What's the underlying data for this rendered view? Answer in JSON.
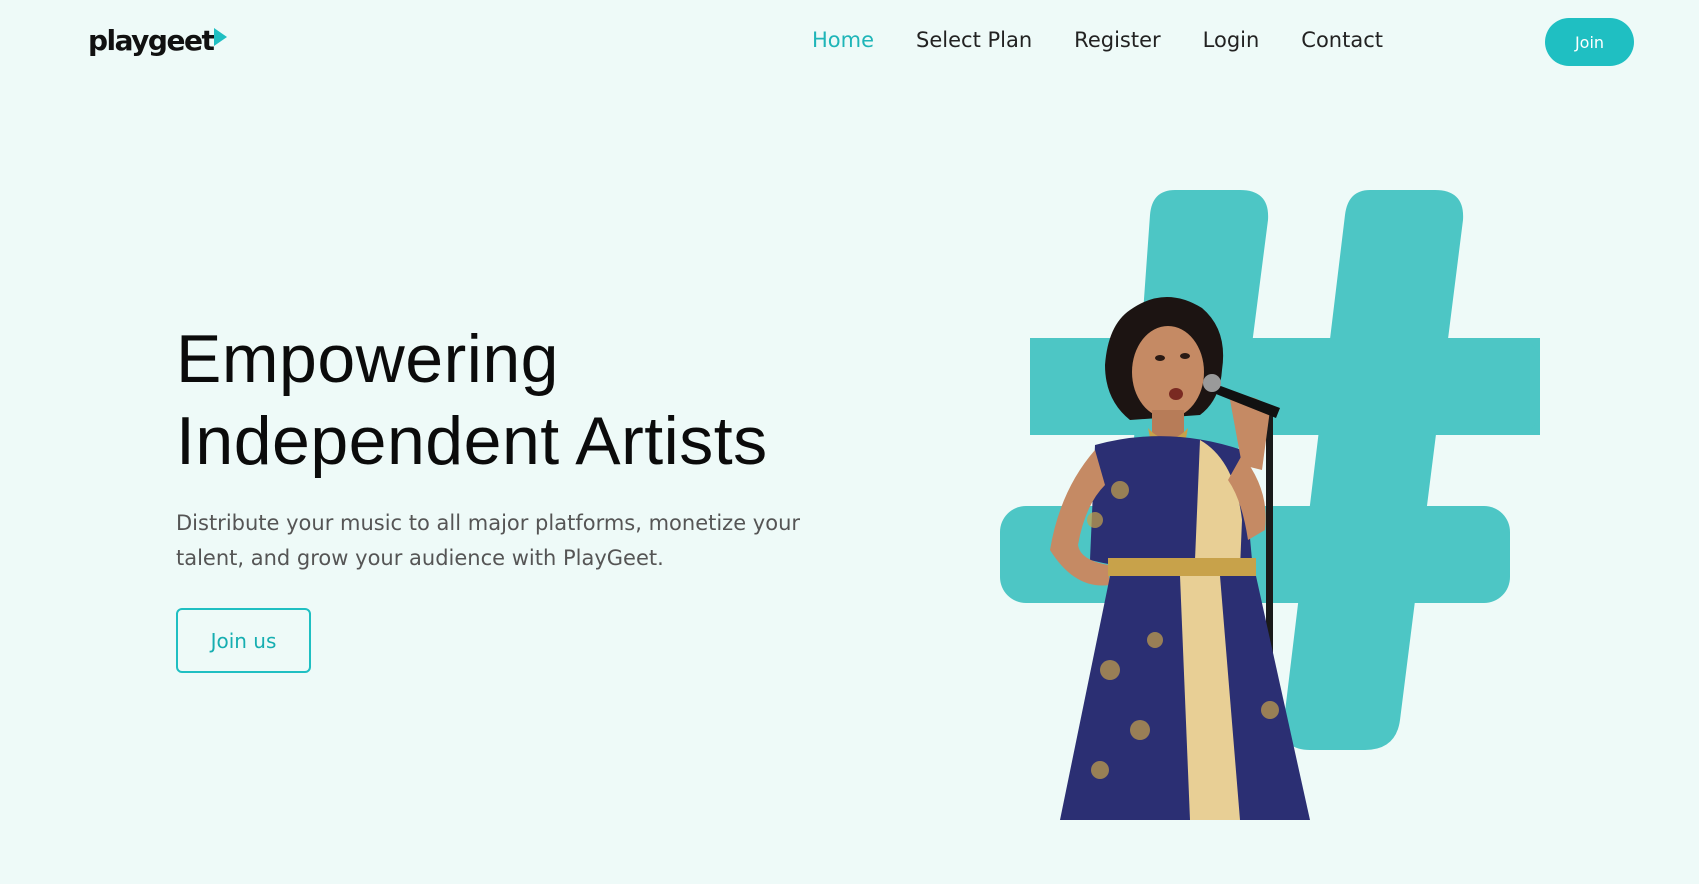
{
  "header": {
    "logo": "playgeet",
    "nav": [
      {
        "label": "Home",
        "active": true
      },
      {
        "label": "Select Plan",
        "active": false
      },
      {
        "label": "Register",
        "active": false
      },
      {
        "label": "Login",
        "active": false
      },
      {
        "label": "Contact",
        "active": false
      }
    ],
    "join_label": "Join"
  },
  "hero": {
    "title_line1": "Empowering",
    "title_line2": "Independent Artists",
    "subtitle": "Distribute your music to all major platforms, monetize your talent, and grow your audience with PlayGeet.",
    "cta_label": "Join us"
  },
  "colors": {
    "accent": "#1fbfc2",
    "hash": "#4dc6c5",
    "background": "#eefaf8"
  },
  "icons": {
    "logo_mark": "play-triangle-icon",
    "hero_graphic": "hashtag-icon"
  }
}
